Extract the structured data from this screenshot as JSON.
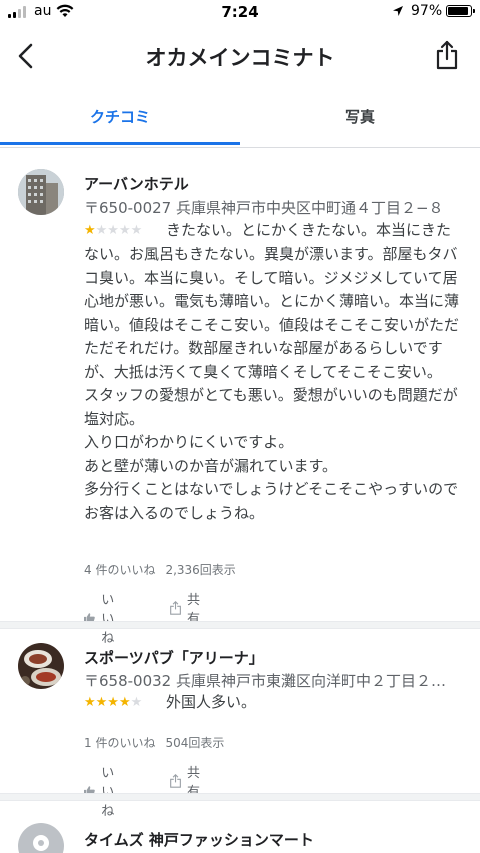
{
  "status_bar": {
    "carrier": "au",
    "time": "7:24",
    "battery": "97%"
  },
  "header": {
    "title": "オカメインコミナト"
  },
  "tabs": [
    {
      "label": "クチコミ",
      "active": true
    },
    {
      "label": "写真",
      "active": false
    }
  ],
  "reviews": [
    {
      "place": "アーバンホテル",
      "address": "〒650-0027 兵庫県神戸市中央区中町通４丁目２−８",
      "rating": 1,
      "text_first": "きたない。とにかくきたない。本当にきた",
      "text_rest": "ない。お風呂もきたない。異臭が漂います。部屋もタバコ臭い。本当に臭い。そして暗い。ジメジメしていて居心地が悪い。電気も薄暗い。とにかく薄暗い。本当に薄暗い。値段はそこそこ安い。値段はそこそこ安いがただただそれだけ。数部屋きれいな部屋があるらしいですが、大抵は汚くて臭くて薄暗くそしてそこそこ安い。\nスタッフの愛想がとても悪い。愛想がいいのも問題だが塩対応。\n入り口がわかりにくいですよ。\nあと壁が薄いのか音が漏れています。\n多分行くことはないでしょうけどそこそこやっすいのでお客は入るのでしょうね。",
      "likes": "4 件のいいね",
      "views": "2,336回表示",
      "like_label": "いいね",
      "share_label": "共有"
    },
    {
      "place": "スポーツパブ「アリーナ」",
      "address": "〒658-0032 兵庫県神戸市東灘区向洋町中２丁目２…",
      "rating": 4,
      "text_first": "外国人多い。",
      "likes": "1 件のいいね",
      "views": "504回表示",
      "like_label": "いいね",
      "share_label": "共有"
    },
    {
      "place": "タイムズ 神戸ファッションマート"
    }
  ],
  "colors": {
    "accent": "#1a73e8",
    "star": "#f4b400",
    "star_empty": "#dadce0"
  },
  "icons": [
    "back-arrow-icon",
    "share-icon",
    "thumbs-up-icon",
    "share-outline-icon",
    "location-arrow-icon",
    "wifi-icon",
    "battery-icon"
  ]
}
